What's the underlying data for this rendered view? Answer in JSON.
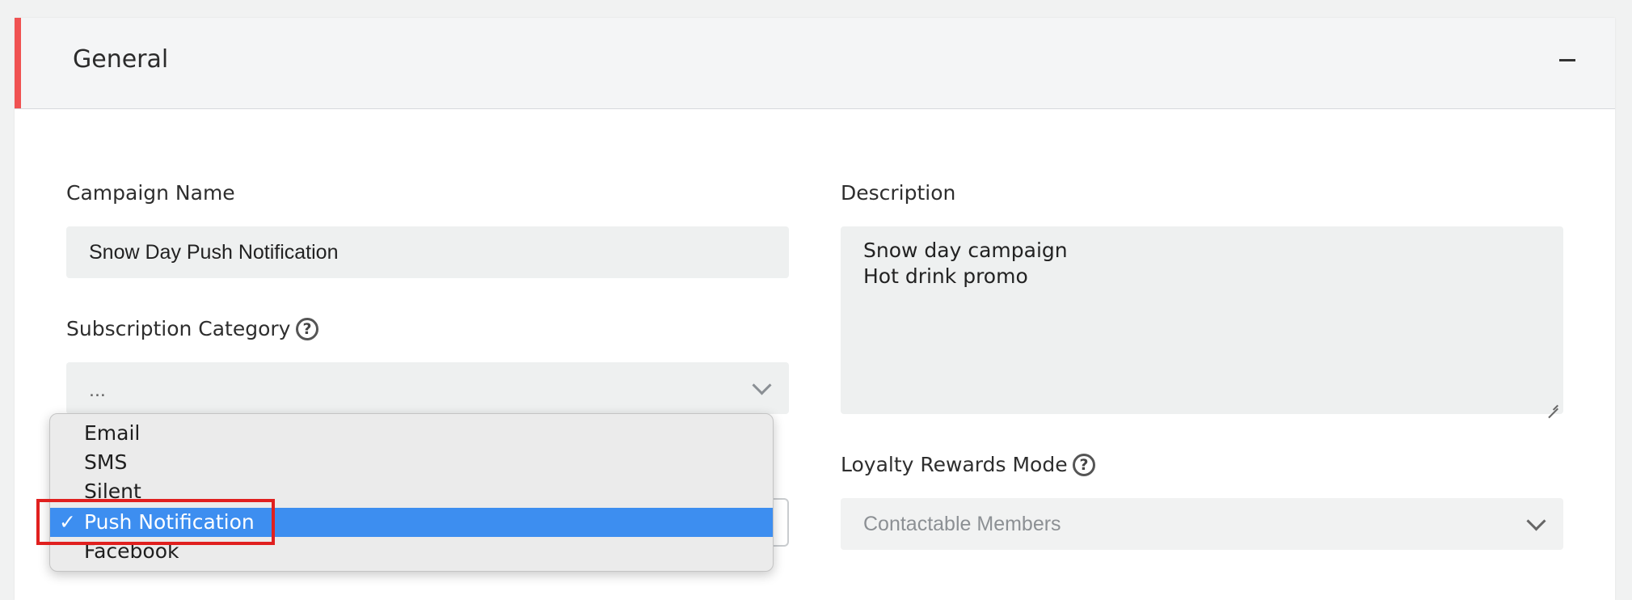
{
  "section": {
    "title": "General",
    "accent_color": "#f05252"
  },
  "campaign_name": {
    "label": "Campaign Name",
    "value": "Snow Day Push Notification"
  },
  "subscription_category": {
    "label": "Subscription Category",
    "selected_display": "...",
    "options": [
      "Email",
      "SMS",
      "Silent",
      "Push Notification",
      "Facebook"
    ],
    "selected_option": "Push Notification",
    "check_mark": "✓"
  },
  "description": {
    "label": "Description",
    "value": "Snow day campaign\nHot drink promo"
  },
  "loyalty_rewards_mode": {
    "label": "Loyalty Rewards Mode",
    "selected": "Contactable Members"
  },
  "help_glyph": "?",
  "colors": {
    "selected_highlight": "#3d8ef0",
    "annotation": "#e0201f"
  }
}
